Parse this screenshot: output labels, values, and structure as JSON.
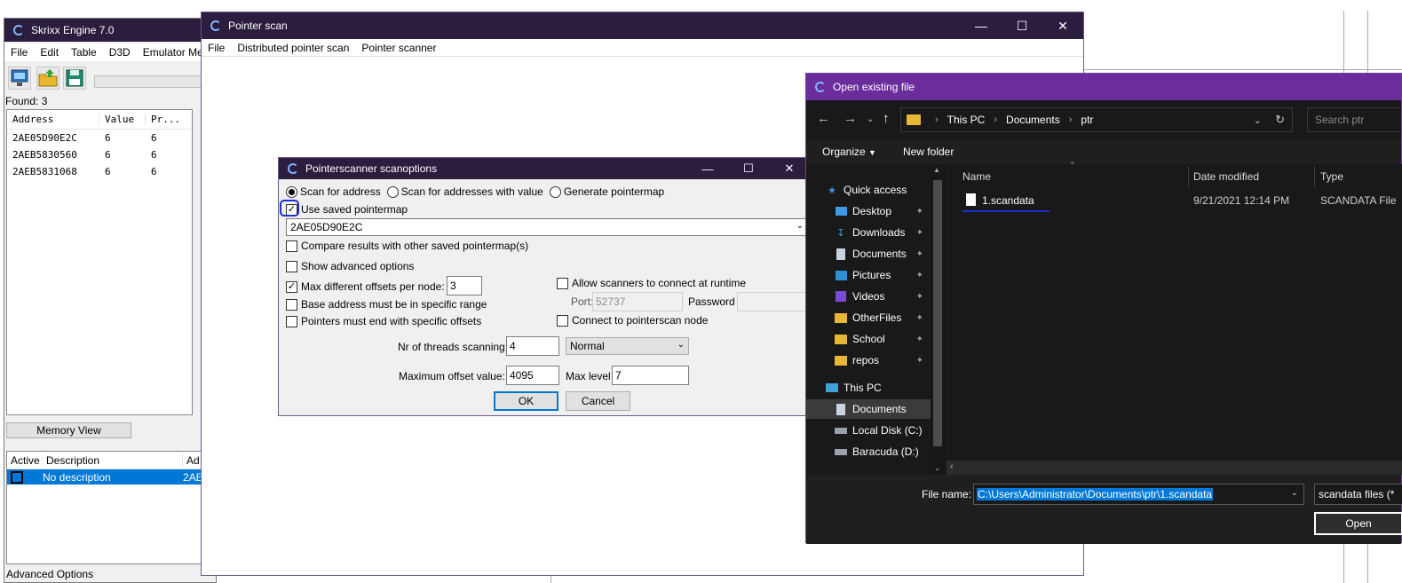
{
  "skrixx": {
    "title": "Skrixx Engine 7.0",
    "menu": [
      "File",
      "Edit",
      "Table",
      "D3D",
      "Emulator Mer"
    ],
    "found_label": "Found: 3",
    "list_headers": [
      "Address",
      "Value",
      "Pr..."
    ],
    "rows": [
      {
        "address": "2AE05D90E2C",
        "value": "6",
        "prev": "6"
      },
      {
        "address": "2AEB5830560",
        "value": "6",
        "prev": "6"
      },
      {
        "address": "2AEB5831068",
        "value": "6",
        "prev": "6"
      }
    ],
    "memory_view_label": "Memory View",
    "table_headers": [
      "Active",
      "Description",
      "Ad"
    ],
    "table_row": {
      "description": "No description",
      "address": "2AE"
    },
    "advanced_options": "Advanced Options"
  },
  "pointer_scan": {
    "title": "Pointer scan",
    "menu": [
      "File",
      "Distributed pointer scan",
      "Pointer scanner"
    ]
  },
  "scan_options": {
    "title": "Pointerscanner scanoptions",
    "radio_scan_address": "Scan for address",
    "radio_scan_value": "Scan for addresses with value",
    "radio_generate": "Generate pointermap",
    "use_saved_pointermap": "Use saved pointermap",
    "pointermap_value": "2AE05D90E2C",
    "compare_results": "Compare results with other saved pointermap(s)",
    "show_advanced": "Show advanced options",
    "max_offsets_label": "Max different offsets per node:",
    "max_offsets_value": "3",
    "base_range": "Base address must be in specific range",
    "end_offsets": "Pointers must end with specific offsets",
    "allow_scanners": "Allow scanners to connect at runtime",
    "port_label": "Port:",
    "port_placeholder": "52737",
    "password_label": "Password",
    "connect_node": "Connect to pointerscan node",
    "threads_label": "Nr of threads scanning:",
    "threads_value": "4",
    "priority_value": "Normal",
    "max_offset_label": "Maximum offset value:",
    "max_offset_value": "4095",
    "max_level_label": "Max level",
    "max_level_value": "7",
    "ok_label": "OK",
    "cancel_label": "Cancel"
  },
  "open_file": {
    "title": "Open existing file",
    "breadcrumb": [
      "This PC",
      "Documents",
      "ptr"
    ],
    "search_placeholder": "Search ptr",
    "organize_label": "Organize",
    "new_folder_label": "New folder",
    "nav": {
      "quick_access": "Quick access",
      "desktop": "Desktop",
      "downloads": "Downloads",
      "documents": "Documents",
      "pictures": "Pictures",
      "videos": "Videos",
      "otherfiles": "OtherFiles",
      "school": "School",
      "repos": "repos",
      "this_pc": "This PC",
      "pc_documents": "Documents",
      "local_disk": "Local Disk (C:)",
      "baracuda": "Baracuda (D:)"
    },
    "columns": {
      "name": "Name",
      "date": "Date modified",
      "type": "Type"
    },
    "file": {
      "name": "1.scandata",
      "date": "9/21/2021 12:14 PM",
      "type": "SCANDATA File"
    },
    "file_name_label": "File name:",
    "file_name_value": "C:\\Users\\Administrator\\Documents\\ptr\\1.scandata",
    "file_type_value": "scandata files (*",
    "open_label": "Open"
  },
  "colors": {
    "titlebar_dark": "#2b1d3d",
    "file_dialog_titlebar": "#6b2d9c",
    "selection_blue": "#0078d7"
  }
}
